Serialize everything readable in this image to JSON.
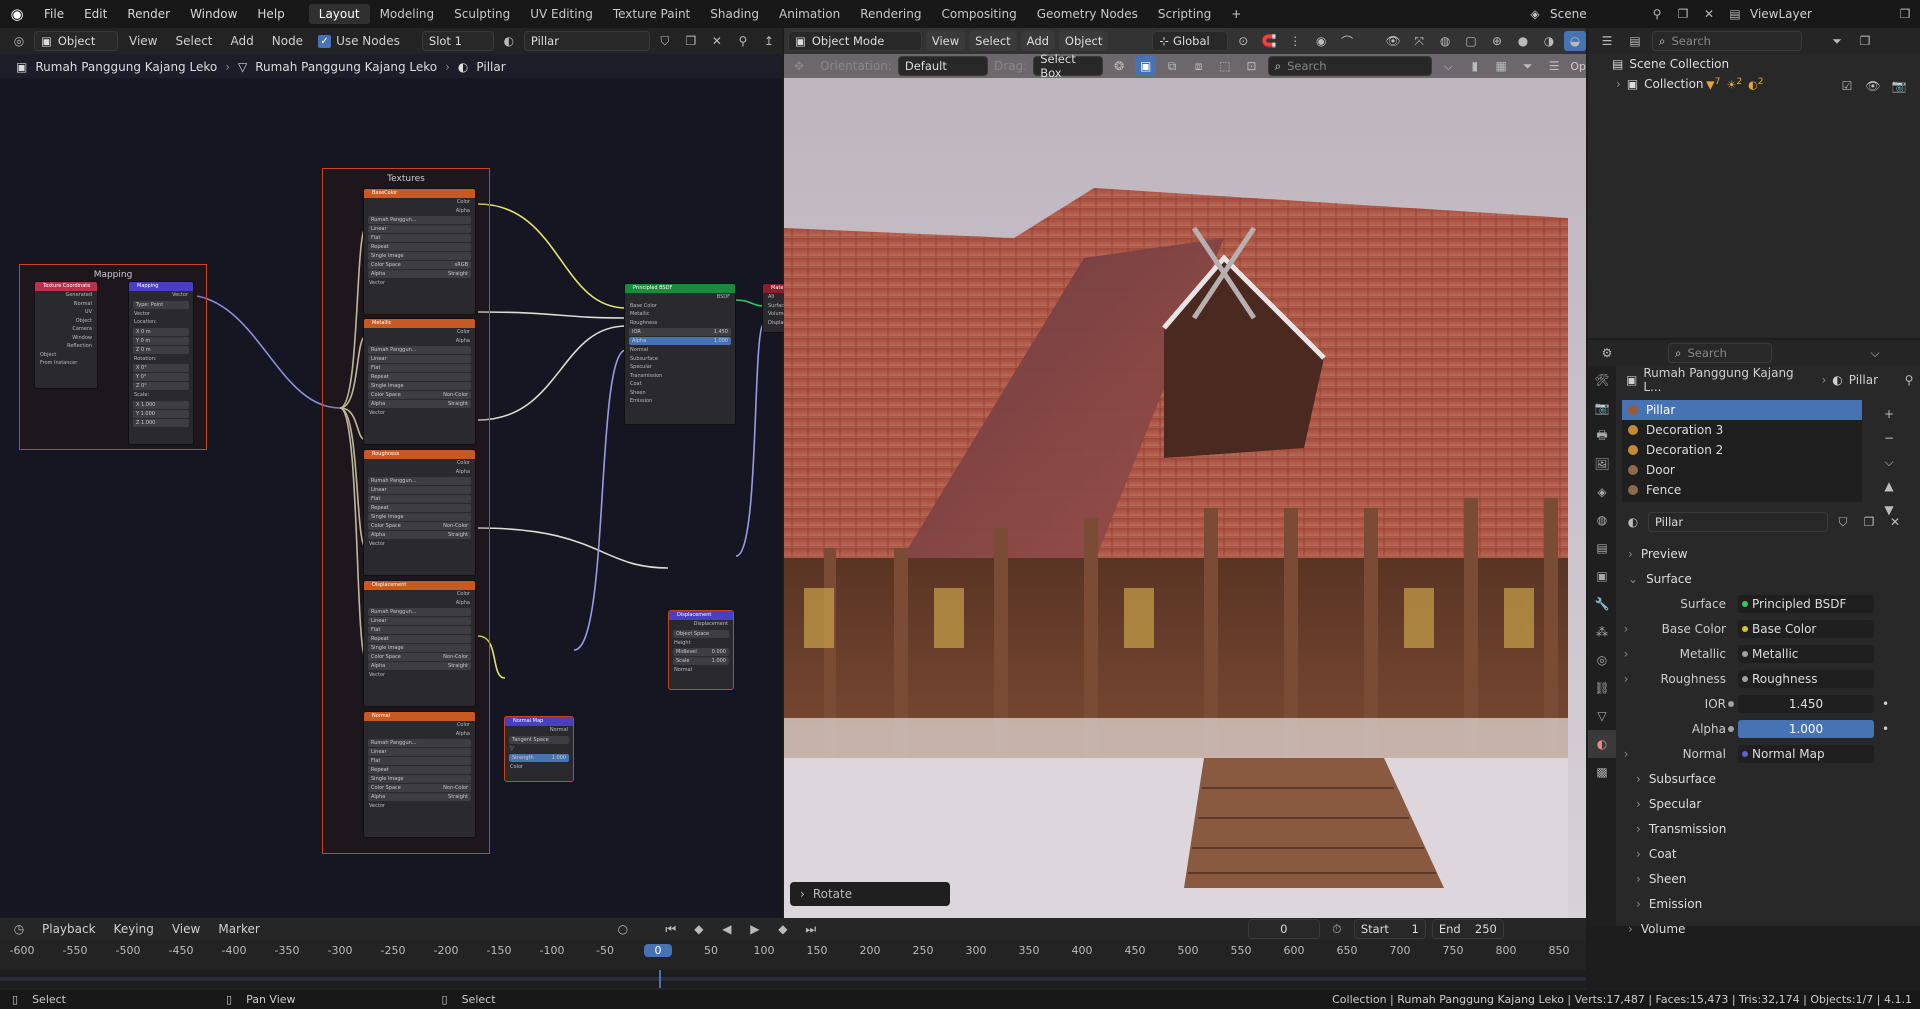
{
  "topbar": {
    "menus": [
      "File",
      "Edit",
      "Render",
      "Window",
      "Help"
    ],
    "workspaces": [
      "Layout",
      "Modeling",
      "Sculpting",
      "UV Editing",
      "Texture Paint",
      "Shading",
      "Animation",
      "Rendering",
      "Compositing",
      "Geometry Nodes",
      "Scripting"
    ],
    "active_workspace": "Layout",
    "add_tab": "+",
    "scene": "Scene",
    "view_layer": "ViewLayer"
  },
  "node_editor": {
    "object_mode": "Object",
    "menus": [
      "View",
      "Select",
      "Add",
      "Node"
    ],
    "use_nodes_label": "Use Nodes",
    "slot": "Slot 1",
    "material": "Pillar",
    "breadcrumb": [
      "Rumah Panggung Kajang Leko",
      "Rumah Panggung Kajang Leko",
      "Pillar"
    ],
    "frames": {
      "textures": "Textures",
      "mapping": "Mapping"
    },
    "nodes": {
      "tex_coord": {
        "title": "Texture Coordinate",
        "outputs": [
          "Generated",
          "Normal",
          "UV",
          "Object",
          "Camera",
          "Window",
          "Reflection"
        ],
        "object_label": "Object",
        "from_instancer": "From Instancer"
      },
      "mapping": {
        "title": "Mapping",
        "output": "Vector",
        "type_label": "Type:",
        "type": "Point",
        "vector": "Vector",
        "location": "Location:",
        "rotation": "Rotation:",
        "scale": "Scale:",
        "axes": [
          "X",
          "Y",
          "Z"
        ],
        "loc_vals": [
          "0 m",
          "0 m",
          "0 m"
        ],
        "rot_vals": [
          "0°",
          "0°",
          "0°"
        ],
        "scale_vals": [
          "1.000",
          "1.000",
          "1.000"
        ]
      },
      "textures": [
        {
          "title": "BaseColor",
          "colorspace": "sRGB",
          "alpha": "Straight"
        },
        {
          "title": "Metallic",
          "colorspace": "Non-Color",
          "alpha": "Straight"
        },
        {
          "title": "Roughness",
          "colorspace": "Non-Color",
          "alpha": "Straight"
        },
        {
          "title": "Displacement",
          "colorspace": "Non-Color",
          "alpha": "Straight"
        },
        {
          "title": "Normal",
          "colorspace": "Non-Color",
          "alpha": "Straight"
        }
      ],
      "tex_common": {
        "image": "Rumah Panggun...",
        "interp": "Linear",
        "proj": "Flat",
        "ext": "Repeat",
        "src": "Single Image",
        "cs_label": "Color Space",
        "alpha_label": "Alpha",
        "vector": "Vector",
        "out_color": "Color",
        "out_alpha": "Alpha"
      },
      "bsdf": {
        "title": "Principled BSDF",
        "output": "BSDF",
        "inputs": [
          "Base Color",
          "Metallic",
          "Roughness"
        ],
        "ior_label": "IOR",
        "ior": "1.450",
        "alpha_label": "Alpha",
        "alpha": "1.000",
        "normal": "Normal",
        "subsections": [
          "Subsurface",
          "Specular",
          "Transmission",
          "Coat",
          "Sheen",
          "Emission"
        ]
      },
      "displacement": {
        "title": "Displacement",
        "output": "Displacement",
        "space": "Object Space",
        "height": "Height",
        "midlevel_label": "Midlevel",
        "midlevel": "0.000",
        "scale_label": "Scale",
        "scale": "1.000",
        "normal": "Normal"
      },
      "normal_map": {
        "title": "Normal Map",
        "output": "Normal",
        "space": "Tangent Space",
        "strength_label": "Strength",
        "strength": "1.000",
        "color": "Color"
      },
      "output": {
        "title": "Mate",
        "inputs": [
          "All",
          "Surface",
          "Volume",
          "Displace"
        ]
      }
    }
  },
  "viewport": {
    "mode": "Object Mode",
    "menus": [
      "View",
      "Select",
      "Add",
      "Object"
    ],
    "transform": "Global",
    "orientation_label": "Orientation:",
    "orientation": "Default",
    "drag_label": "Drag:",
    "drag": "Select Box",
    "search_placeholder": "Search",
    "last_op": "Rotate",
    "op_tail": "Op"
  },
  "outliner": {
    "search_placeholder": "Search",
    "scene_collection": "Scene Collection",
    "collection": "Collection",
    "collection_counts": [
      "7",
      "2",
      "2"
    ]
  },
  "properties": {
    "search_placeholder": "Search",
    "breadcrumb": [
      "Rumah Panggung Kajang L...",
      "Pillar"
    ],
    "materials": [
      "Pillar",
      "Decoration 3",
      "Decoration 2",
      "Door",
      "Fence"
    ],
    "selected_material": "Pillar",
    "material_name": "Pillar",
    "sections": {
      "preview": "Preview",
      "surface": "Surface",
      "volume": "Volume"
    },
    "rows": [
      {
        "label": "Surface",
        "value": "Principled BSDF",
        "dot": "#2fc95e",
        "expand": false,
        "kind": "link"
      },
      {
        "label": "Base Color",
        "value": "Base Color",
        "dot": "#c7c729",
        "expand": true,
        "kind": "link"
      },
      {
        "label": "Metallic",
        "value": "Metallic",
        "dot": "#a0a0a0",
        "expand": true,
        "kind": "link"
      },
      {
        "label": "Roughness",
        "value": "Roughness",
        "dot": "#a0a0a0",
        "expand": true,
        "kind": "link"
      },
      {
        "label": "IOR",
        "value": "1.450",
        "dot": "#a0a0a0",
        "expand": false,
        "kind": "num"
      },
      {
        "label": "Alpha",
        "value": "1.000",
        "dot": "#a0a0a0",
        "expand": false,
        "kind": "blue"
      },
      {
        "label": "Normal",
        "value": "Normal Map",
        "dot": "#6363c7",
        "expand": true,
        "kind": "link"
      }
    ],
    "subsections": [
      "Subsurface",
      "Specular",
      "Transmission",
      "Coat",
      "Sheen",
      "Emission"
    ]
  },
  "timeline": {
    "menus": [
      "Playback",
      "Keying",
      "View",
      "Marker"
    ],
    "current_frame": "0",
    "start_label": "Start",
    "start": "1",
    "end_label": "End",
    "end": "250",
    "ticks": [
      "-600",
      "-550",
      "-500",
      "-450",
      "-400",
      "-350",
      "-300",
      "-250",
      "-200",
      "-150",
      "-100",
      "-50",
      "0",
      "50",
      "100",
      "150",
      "200",
      "250",
      "300",
      "350",
      "400",
      "450",
      "500",
      "550",
      "600",
      "650",
      "700",
      "750",
      "800",
      "850"
    ]
  },
  "statusbar": {
    "left_action": "Select",
    "mid_action": "Pan View",
    "right_action": "Select",
    "stats": "Collection | Rumah Panggung Kajang Leko | Verts:17,487 | Faces:15,473 | Tris:32,174 | Objects:1/7 | 4.1.1"
  },
  "colors": {
    "accent": "#4772b3",
    "frame": "#c9451e",
    "texture_header": "#c75a22",
    "shader_header": "#1d8a3a",
    "vector_header": "#4a3fc2",
    "input_header": "#b8314d"
  }
}
